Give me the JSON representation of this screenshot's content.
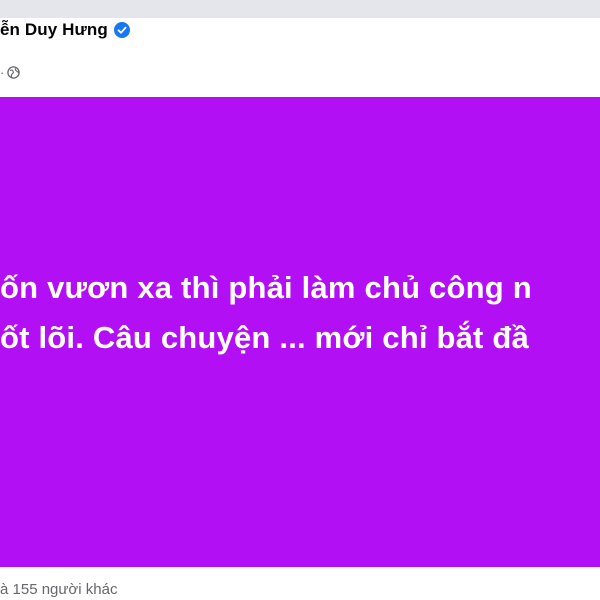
{
  "post": {
    "author_name": "ễn Duy Hưng",
    "author_verified": true,
    "meta_text": "· ",
    "audience_icon": "globe-icon",
    "banner_color": "#b30ff5",
    "text_color": "#ffffff",
    "text_lines": [
      "ốn vươn xa thì phải làm chủ công n",
      "ốt lõi. Câu chuyện ... mới chỉ bắt đầ"
    ],
    "reactions_text": "à 155 người khác"
  }
}
